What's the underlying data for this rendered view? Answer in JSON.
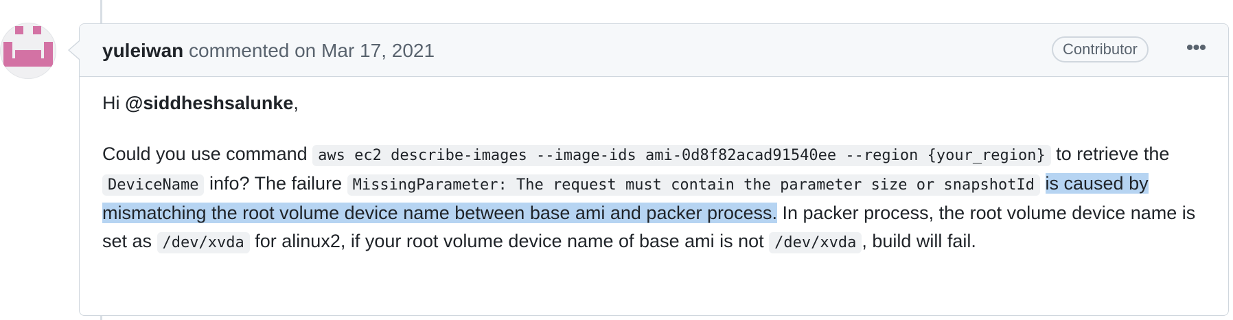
{
  "comment": {
    "author": "yuleiwan",
    "action_text": " commented on ",
    "timestamp": "Mar 17, 2021",
    "role_badge": "Contributor",
    "more_icon": "kebab-horizontal-icon",
    "greeting": {
      "prefix": "Hi ",
      "mention": "@siddheshsalunke",
      "suffix": ","
    },
    "paragraph": {
      "t1": "Could you use command ",
      "code1": "aws ec2 describe-images --image-ids ami-0d8f82acad91540ee --region {your_region}",
      "t2": " to retrieve the ",
      "code2": "DeviceName",
      "t3": " info? The failure ",
      "code3": "MissingParameter: The request must contain the parameter size or snapshotId",
      "t4": " ",
      "highlighted": "is caused by mismatching the root volume device name between base ami and packer process.",
      "t5": " In packer process, the root volume device name is set as ",
      "code4": "/dev/xvda",
      "t6": " for alinux2, if your root volume device name of base ami is not ",
      "code5": "/dev/xvda",
      "t7": ", build will fail."
    }
  },
  "colors": {
    "avatar_pink": "#d372a4",
    "selection": "#b6d4f2",
    "border": "#d0d7de",
    "header_bg": "#f6f8fa"
  }
}
